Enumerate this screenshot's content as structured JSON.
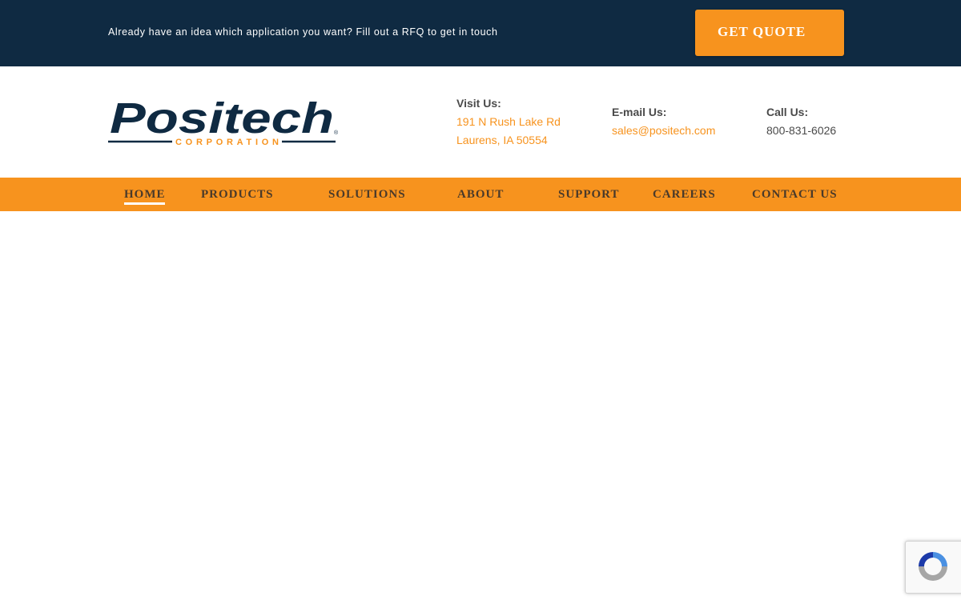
{
  "topbar": {
    "message": "Already have an idea which application you want? Fill out a RFQ to get in touch",
    "quote_label": "GET QUOTE"
  },
  "header": {
    "logo": {
      "brand": "Positech",
      "subtitle": "CORPORATION",
      "trademark": "®"
    },
    "visit": {
      "label": "Visit Us:",
      "line1": "191 N Rush Lake Rd",
      "line2": "Laurens, IA 50554"
    },
    "email": {
      "label": "E-mail Us:",
      "value": "sales@positech.com"
    },
    "call": {
      "label": "Call Us:",
      "value": "800-831-6026"
    }
  },
  "nav": {
    "items": [
      "HOME",
      "PRODUCTS",
      "SOLUTIONS",
      "ABOUT",
      "SUPPORT",
      "CAREERS",
      "CONTACT US"
    ],
    "active": "HOME"
  },
  "colors": {
    "navy": "#0f2a42",
    "orange": "#f7931e",
    "text_gray": "#4a4a4a"
  },
  "icons": {
    "recaptcha": "recaptcha-icon"
  }
}
